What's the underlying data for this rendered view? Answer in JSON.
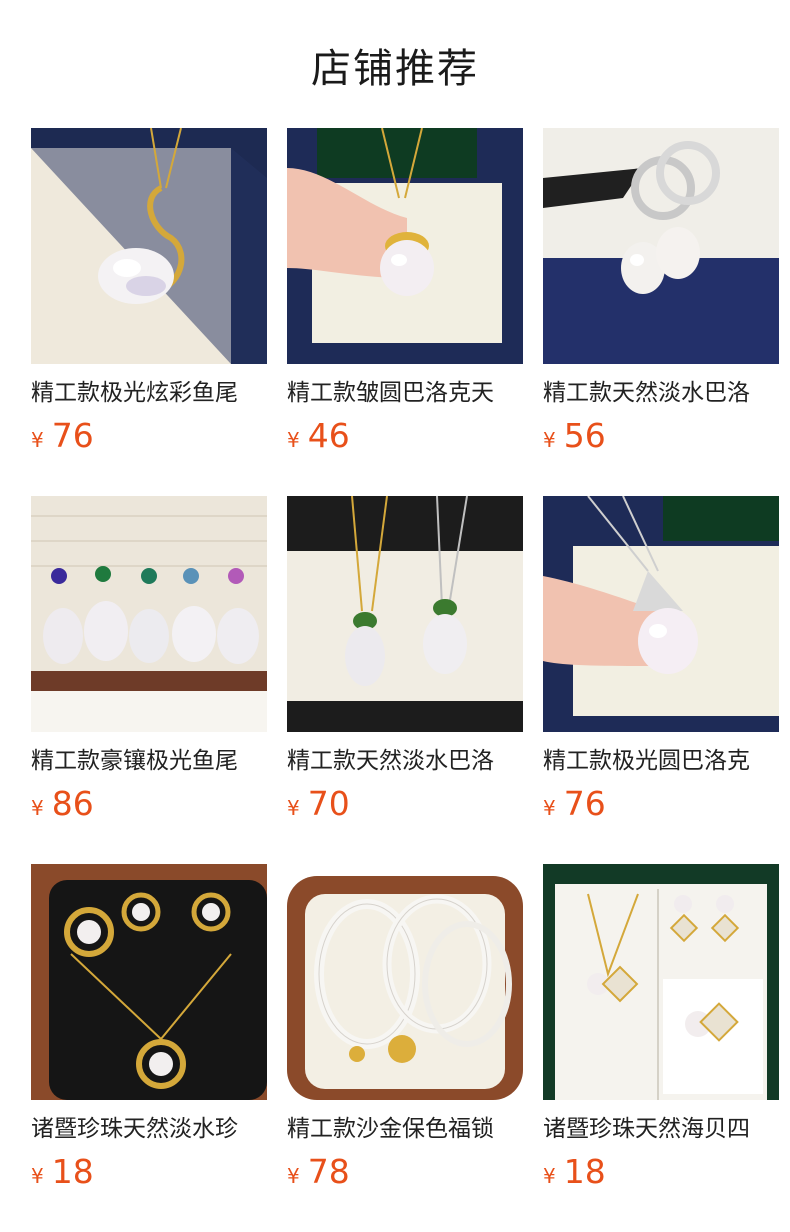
{
  "section_title": "店铺推荐",
  "products": [
    {
      "name": "精工款极光炫彩鱼尾",
      "currency": "¥",
      "price": "76",
      "thumb_icon": "pearl-swan-pendant-icon"
    },
    {
      "name": "精工款皱圆巴洛克天",
      "currency": "¥",
      "price": "46",
      "thumb_icon": "pearl-pendant-icon"
    },
    {
      "name": "精工款天然淡水巴洛",
      "currency": "¥",
      "price": "56",
      "thumb_icon": "pearl-earrings-icon"
    },
    {
      "name": "精工款豪镶极光鱼尾",
      "currency": "¥",
      "price": "86",
      "thumb_icon": "pearl-drops-row-icon"
    },
    {
      "name": "精工款天然淡水巴洛",
      "currency": "¥",
      "price": "70",
      "thumb_icon": "pearl-necklaces-icon"
    },
    {
      "name": "精工款极光圆巴洛克",
      "currency": "¥",
      "price": "76",
      "thumb_icon": "pearl-pendant-icon"
    },
    {
      "name": "诸暨珍珠天然淡水珍",
      "currency": "¥",
      "price": "18",
      "thumb_icon": "pearl-jewelry-set-icon"
    },
    {
      "name": "精工款沙金保色福锁",
      "currency": "¥",
      "price": "78",
      "thumb_icon": "pearl-bracelets-icon"
    },
    {
      "name": "诸暨珍珠天然海贝四",
      "currency": "¥",
      "price": "18",
      "thumb_icon": "pearl-clover-set-icon"
    }
  ]
}
